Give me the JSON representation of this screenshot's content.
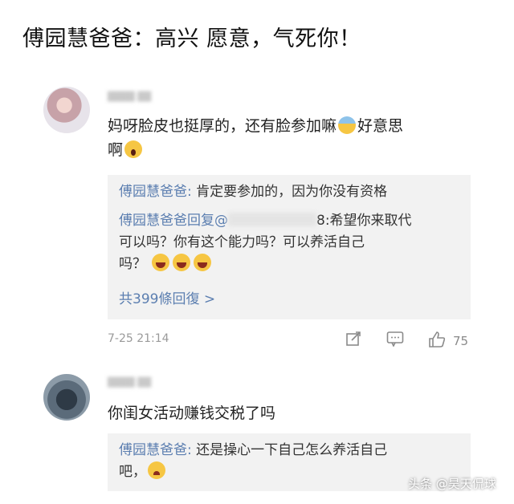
{
  "headline": "傅园慧爸爸：高兴 愿意，气死你！",
  "comment1": {
    "text_line1": "妈呀脸皮也挺厚的，还有脸参加嘛",
    "text_tail": "好意思",
    "text_line2": "啊",
    "replies": {
      "reply1_user": "傅园慧爸爸:",
      "reply1_text": " 肯定要参加的，因为你没有资格",
      "reply2_user": "傅园慧爸爸回复",
      "reply2_mention": "@",
      "reply2_suffix": "8:",
      "reply2_text": "希望你来取代",
      "reply2_line2": "可以吗？你有这个能力吗？可以养活自己",
      "reply2_line3": "吗？",
      "more_link": "共399條回復 >"
    },
    "timestamp": "7-25 21:14",
    "like_count": "75",
    "icons": [
      "share-icon",
      "comment-icon",
      "like-icon"
    ]
  },
  "comment2": {
    "text": "你闺女活动赚钱交税了吗",
    "reply_user": "傅园慧爸爸:",
    "reply_text": " 还是操心一下自己怎么养活自己",
    "reply_line2": "吧，"
  },
  "watermark": "头条 @昊天侃球"
}
